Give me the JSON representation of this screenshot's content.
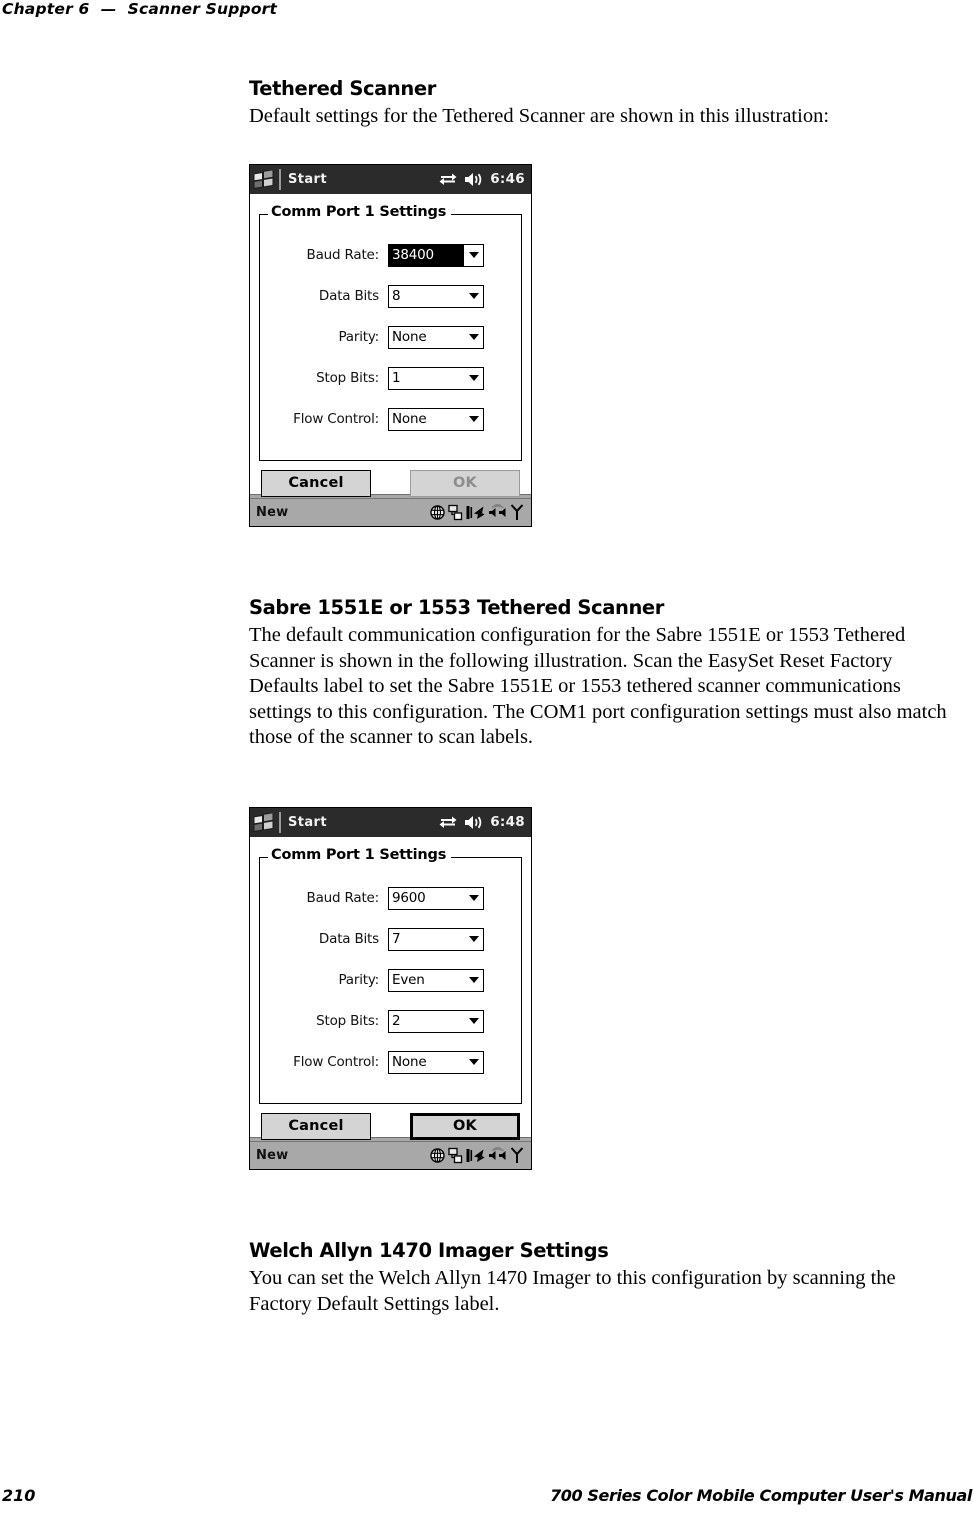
{
  "header": {
    "chapter": "Chapter 6",
    "dash": "—",
    "title": "Scanner Support",
    "full": "Chapter 6  —  Scanner Support"
  },
  "sections": [
    {
      "heading": "Tethered Scanner",
      "body": "Default settings for the Tethered Scanner are shown in this illustration:"
    },
    {
      "heading": "Sabre 1551E or 1553 Tethered Scanner",
      "body": "The default communication configuration for the Sabre 1551E or 1553 Tethered Scanner is shown in the following illustration. Scan the EasySet Reset Factory Defaults label to set the Sabre 1551E or 1553 tethered scanner communications settings to this configuration. The COM1 port configuration settings must also match those of the scanner to scan labels."
    },
    {
      "heading": "Welch Allyn 1470 Imager Settings",
      "body": "You can set the Welch Allyn 1470 Imager to this configuration by scanning the Factory Default Settings label."
    }
  ],
  "screenshots": [
    {
      "name": "tethered-scanner-defaults",
      "titlebar": {
        "logo": "windows-flag-icon",
        "start_label": "Start",
        "tray_icons": [
          "connectivity-icon",
          "speaker-icon"
        ],
        "clock": "6:46"
      },
      "groupbox_title": "Comm Port 1 Settings",
      "fields": [
        {
          "label": "Baud Rate:",
          "value": "38400",
          "selected": true
        },
        {
          "label": "Data Bits",
          "value": "8",
          "selected": false
        },
        {
          "label": "Parity:",
          "value": "None",
          "selected": false
        },
        {
          "label": "Stop Bits:",
          "value": "1",
          "selected": false
        },
        {
          "label": "Flow Control:",
          "value": "None",
          "selected": false
        }
      ],
      "buttons": {
        "cancel": "Cancel",
        "ok": "OK",
        "ok_state": "disabled"
      },
      "taskbar": {
        "label": "New",
        "tray_icons": [
          "globe-icon",
          "network-icon",
          "scanner-icon",
          "volume-icon",
          "antenna-icon"
        ]
      }
    },
    {
      "name": "sabre-1551e-1553-defaults",
      "titlebar": {
        "logo": "windows-flag-icon",
        "start_label": "Start",
        "tray_icons": [
          "connectivity-icon",
          "speaker-icon"
        ],
        "clock": "6:48"
      },
      "groupbox_title": "Comm Port 1 Settings",
      "fields": [
        {
          "label": "Baud Rate:",
          "value": "9600",
          "selected": false
        },
        {
          "label": "Data Bits",
          "value": "7",
          "selected": false
        },
        {
          "label": "Parity:",
          "value": "Even",
          "selected": false
        },
        {
          "label": "Stop Bits:",
          "value": "2",
          "selected": false
        },
        {
          "label": "Flow Control:",
          "value": "None",
          "selected": false
        }
      ],
      "buttons": {
        "cancel": "Cancel",
        "ok": "OK",
        "ok_state": "default"
      },
      "taskbar": {
        "label": "New",
        "tray_icons": [
          "globe-icon",
          "network-icon",
          "scanner-icon",
          "volume-icon",
          "antenna-icon"
        ]
      }
    }
  ],
  "footer": {
    "page_number": "210",
    "manual_title": "700 Series Color Mobile Computer User's Manual"
  },
  "colors": {
    "titlebar_bg": "#2b2b2b",
    "taskbar_bg": "#a8a8a8",
    "button_bg": "#d4d4d4",
    "disabled_text": "#8d8d8d",
    "page_bg": "#ffffff",
    "text": "#000000"
  }
}
